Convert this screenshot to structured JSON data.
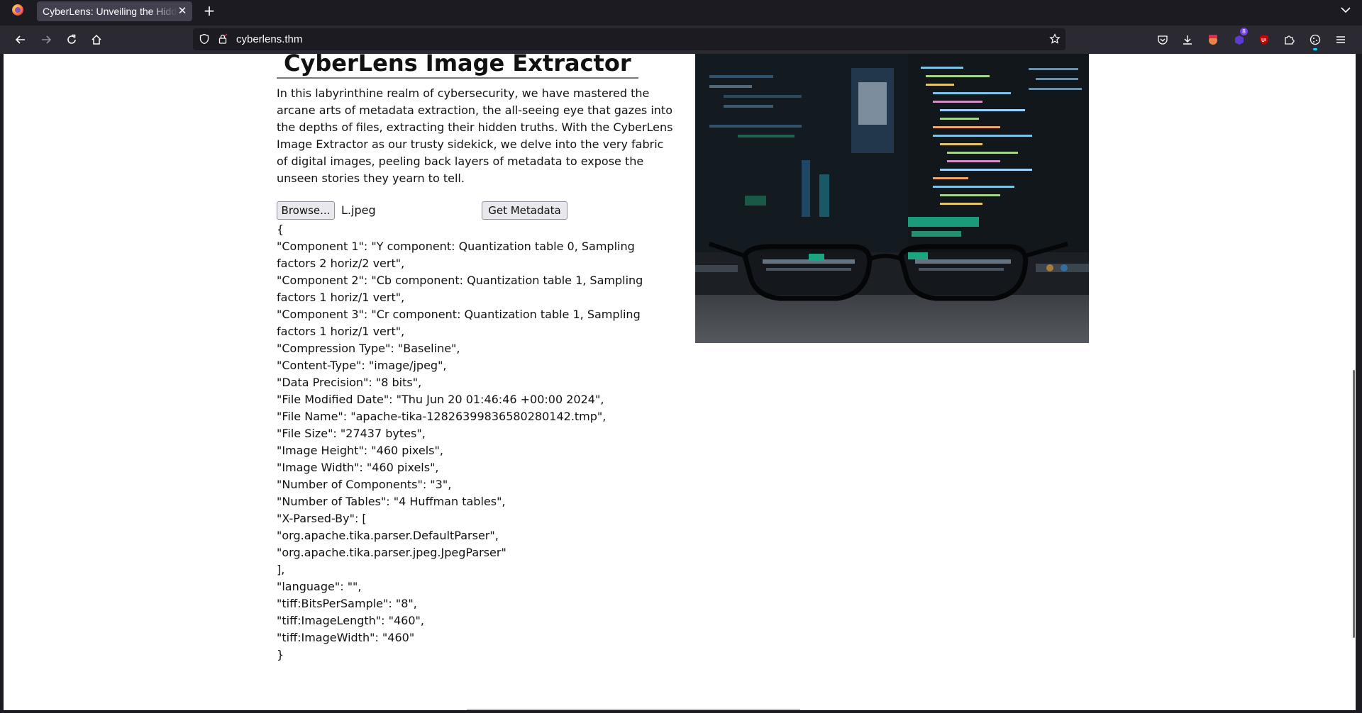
{
  "browser": {
    "tab_title": "CyberLens: Unveiling the Hidden Matrix",
    "url": "cyberlens.thm",
    "extension_badge": "8"
  },
  "page": {
    "title": "CyberLens Image Extractor",
    "intro": "In this labyrinthine realm of cybersecurity, we have mastered the arcane arts of metadata extraction, the all-seeing eye that gazes into the depths of files, extracting their hidden truths. With the CyberLens Image Extractor as our trusty sidekick, we delve into the very fabric of digital images, peeling back layers of metadata to expose the unseen stories they yearn to tell.",
    "browse_label": "Browse...",
    "selected_file": "L.jpeg",
    "submit_label": "Get Metadata",
    "metadata_lines": [
      "{",
      "\"Component 1\": \"Y component: Quantization table 0, Sampling factors 2 horiz/2 vert\",",
      "\"Component 2\": \"Cb component: Quantization table 1, Sampling factors 1 horiz/1 vert\",",
      "\"Component 3\": \"Cr component: Quantization table 1, Sampling factors 1 horiz/1 vert\",",
      "\"Compression Type\": \"Baseline\",",
      "\"Content-Type\": \"image/jpeg\",",
      "\"Data Precision\": \"8 bits\",",
      "\"File Modified Date\": \"Thu Jun 20 01:46:46 +00:00 2024\",",
      "\"File Name\": \"apache-tika-12826399836580280142.tmp\",",
      "\"File Size\": \"27437 bytes\",",
      "\"Image Height\": \"460 pixels\",",
      "\"Image Width\": \"460 pixels\",",
      "\"Number of Components\": \"3\",",
      "\"Number of Tables\": \"4 Huffman tables\",",
      "\"X-Parsed-By\": [",
      "\"org.apache.tika.parser.DefaultParser\",",
      "\"org.apache.tika.parser.jpeg.JpegParser\"",
      "],",
      "\"language\": \"\",",
      "\"tiff:BitsPerSample\": \"8\",",
      "\"tiff:ImageLength\": \"460\",",
      "\"tiff:ImageWidth\": \"460\"",
      "}"
    ]
  },
  "colors": {
    "chrome_dark": "#1c1b22",
    "toolbar": "#2b2a33",
    "tab_active": "#42414d",
    "page_bg": "#ffffff"
  }
}
